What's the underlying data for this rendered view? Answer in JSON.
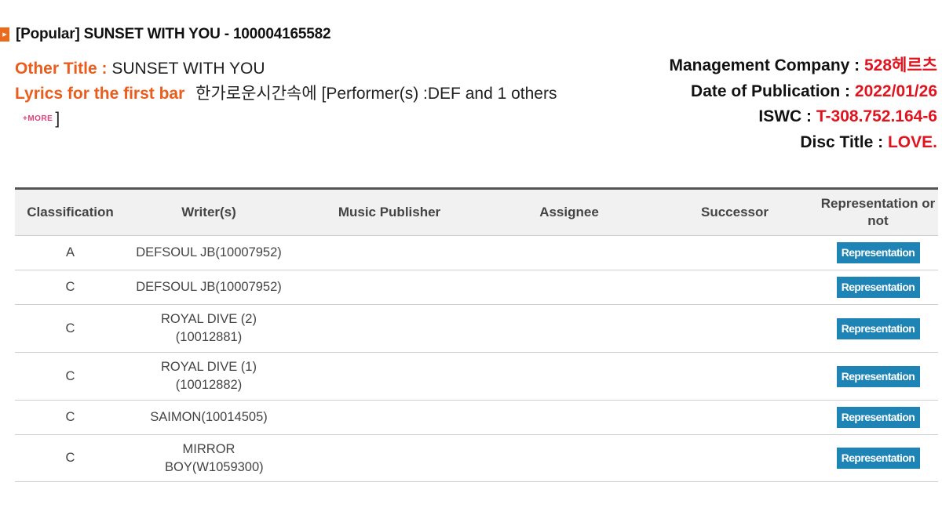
{
  "header": {
    "title": "[Popular] SUNSET WITH YOU - 100004165582"
  },
  "info": {
    "other_title_label": "Other Title :",
    "other_title_value": "SUNSET WITH YOU",
    "lyrics_label": "Lyrics for the first bar",
    "lyrics_value": "한가로운시간속에",
    "performers_open": "[Performer(s) :DEF and 1 others",
    "more_label": "+MORE",
    "performers_close": "]"
  },
  "right_info": {
    "management_label": "Management Company :",
    "management_value": "528헤르츠",
    "publication_label": "Date of Publication :",
    "publication_value": "2022/01/26",
    "iswc_label": "ISWC :",
    "iswc_value": "T-308.752.164-6",
    "disc_label": "Disc Title :",
    "disc_value": "LOVE."
  },
  "table": {
    "headers": [
      "Classification",
      "Writer(s)",
      "Music Publisher",
      "Assignee",
      "Successor",
      "Representation or not"
    ],
    "rows": [
      {
        "classification": "A",
        "writer": "DEFSOUL JB(10007952)",
        "publisher": "",
        "assignee": "",
        "successor": "",
        "representation": "Representation"
      },
      {
        "classification": "C",
        "writer": "DEFSOUL JB(10007952)",
        "publisher": "",
        "assignee": "",
        "successor": "",
        "representation": "Representation"
      },
      {
        "classification": "C",
        "writer": "ROYAL DIVE (2) (10012881)",
        "publisher": "",
        "assignee": "",
        "successor": "",
        "representation": "Representation"
      },
      {
        "classification": "C",
        "writer": "ROYAL DIVE (1) (10012882)",
        "publisher": "",
        "assignee": "",
        "successor": "",
        "representation": "Representation"
      },
      {
        "classification": "C",
        "writer": "SAIMON(10014505)",
        "publisher": "",
        "assignee": "",
        "successor": "",
        "representation": "Representation"
      },
      {
        "classification": "C",
        "writer": "MIRROR BOY(W1059300)",
        "publisher": "",
        "assignee": "",
        "successor": "",
        "representation": "Representation"
      }
    ]
  },
  "colors": {
    "accent_orange": "#ea5d1c",
    "value_red": "#e0141f",
    "button_blue": "#1d84b5",
    "more_pink": "#e0407a"
  }
}
